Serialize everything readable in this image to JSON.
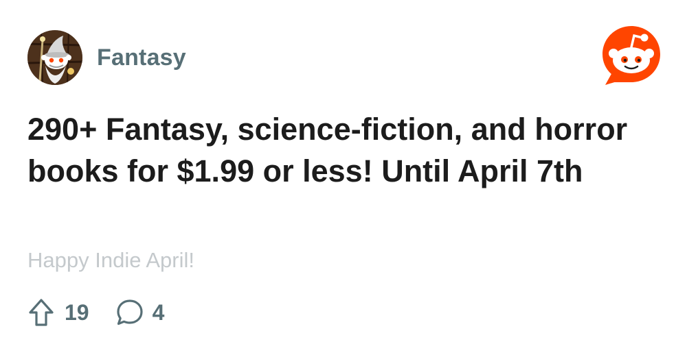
{
  "community": {
    "name": "Fantasy",
    "avatar_icon": "community-avatar-wizard-snoo"
  },
  "brand": {
    "logo_icon": "reddit-logo-icon",
    "accent_color": "#ff4500"
  },
  "post": {
    "title": "290+ Fantasy, science-fiction, and horror books for $1.99 or less! Until April 7th",
    "body_preview": "Happy Indie April!"
  },
  "actions": {
    "upvote_icon": "upvote-arrow-icon",
    "upvote_count": "19",
    "comment_icon": "comment-bubble-icon",
    "comment_count": "4"
  },
  "colors": {
    "title_text": "#1c1c1c",
    "meta_text": "#576f76",
    "body_text": "#c4c9cc"
  }
}
